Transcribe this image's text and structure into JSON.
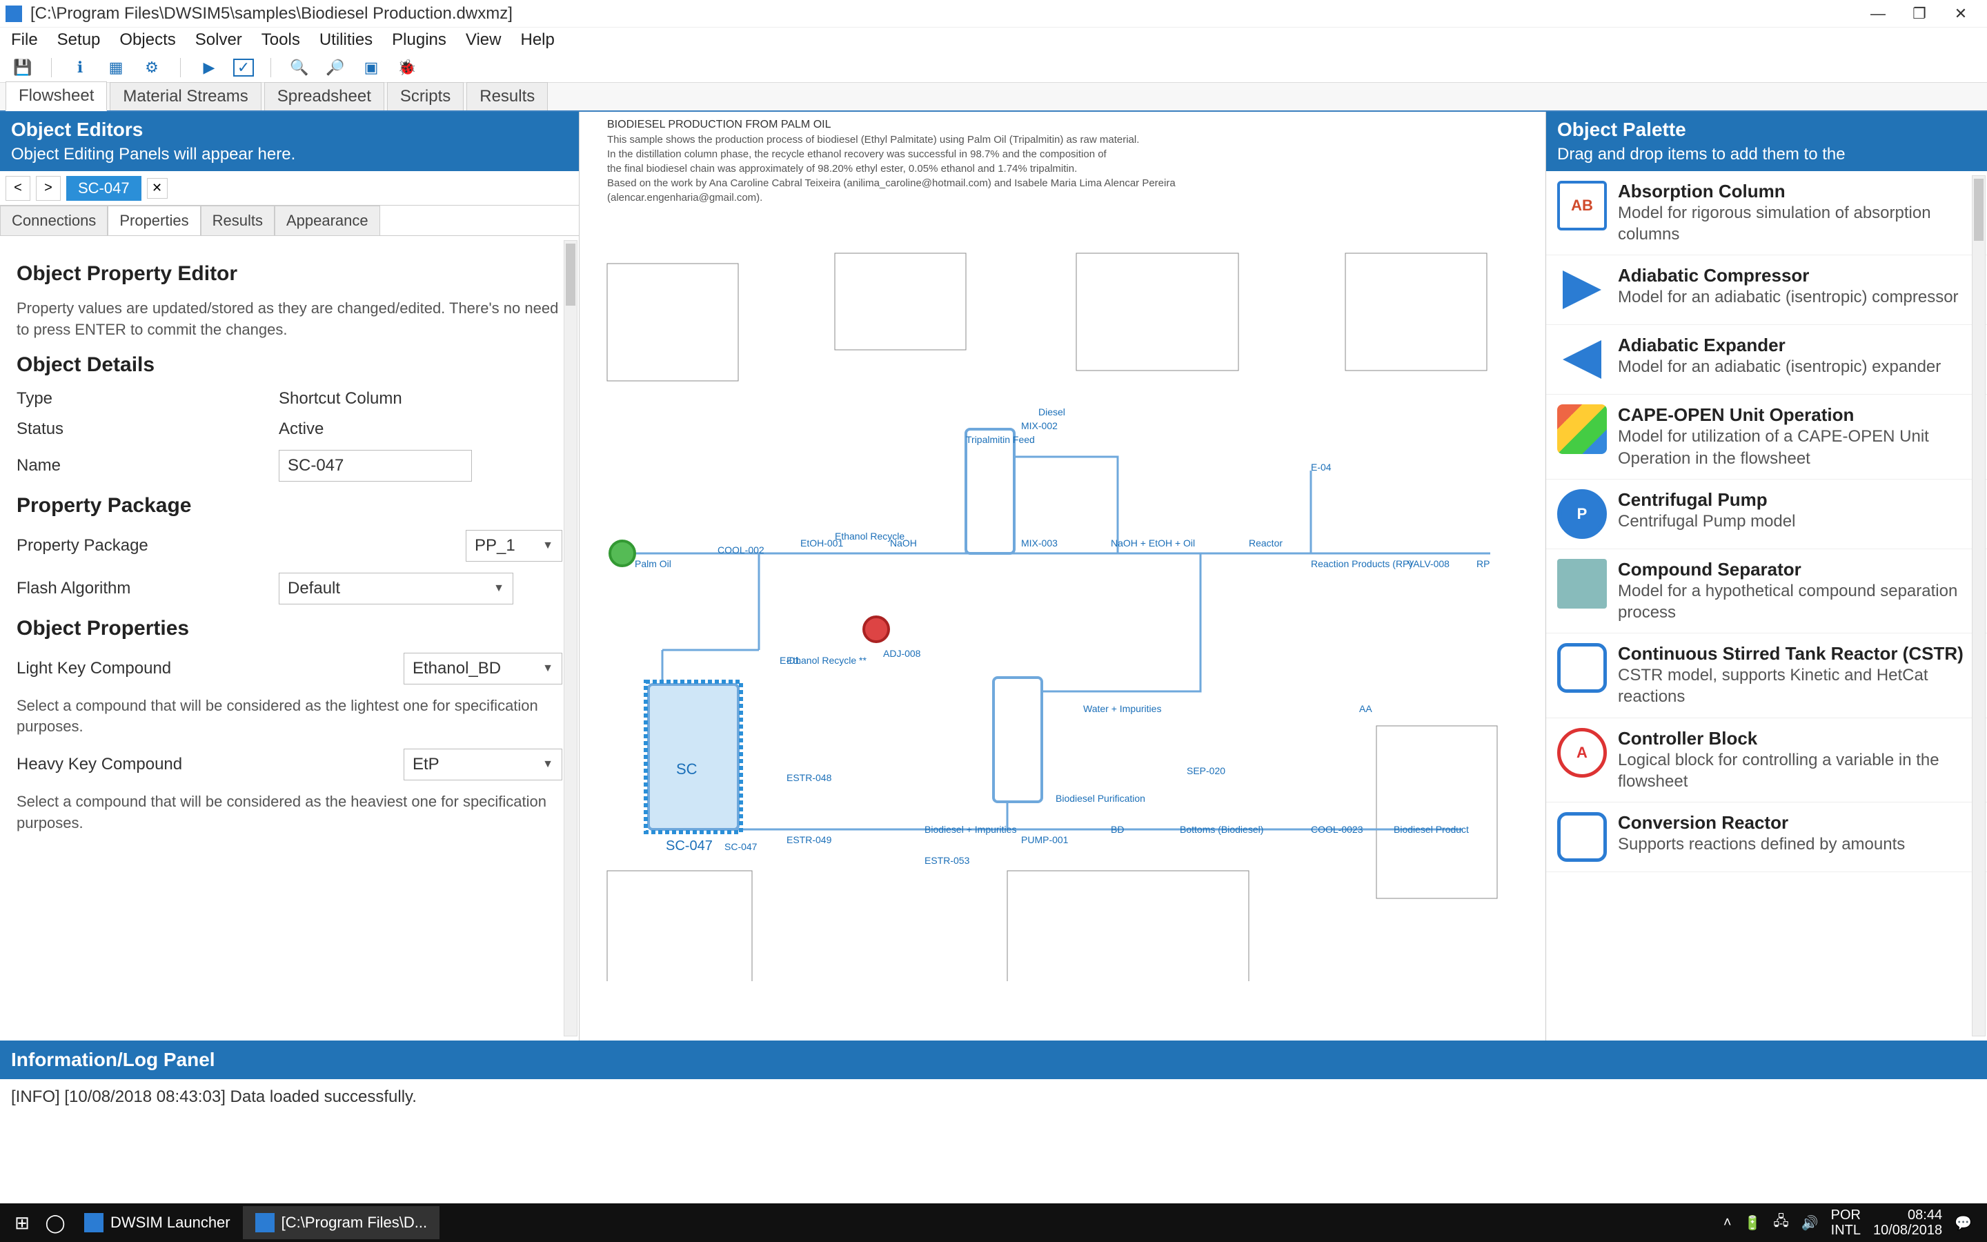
{
  "window": {
    "title": "[C:\\Program Files\\DWSIM5\\samples\\Biodiesel Production.dwxmz]"
  },
  "menubar": [
    "File",
    "Setup",
    "Objects",
    "Solver",
    "Tools",
    "Utilities",
    "Plugins",
    "View",
    "Help"
  ],
  "toolbar_icons": [
    "save-icon",
    "info-icon",
    "grid-icon",
    "settings-icon",
    "play-icon",
    "check-icon",
    "zoom-in-icon",
    "zoom-out-icon",
    "zoom-fit-icon",
    "debug-icon"
  ],
  "main_tabs": [
    "Flowsheet",
    "Material Streams",
    "Spreadsheet",
    "Scripts",
    "Results"
  ],
  "main_tab_active": 0,
  "left": {
    "header_title": "Object Editors",
    "header_sub": "Object Editing Panels will appear here.",
    "breadcrumb_active": "SC-047",
    "subtabs": [
      "Connections",
      "Properties",
      "Results",
      "Appearance"
    ],
    "subtab_active": 1,
    "editor": {
      "title": "Object Property Editor",
      "hint": "Property values are updated/stored as they are changed/edited. There's no need to press ENTER to commit the changes.",
      "section_details": "Object Details",
      "row_type_label": "Type",
      "row_type_value": "Shortcut Column",
      "row_status_label": "Status",
      "row_status_value": "Active",
      "row_name_label": "Name",
      "row_name_value": "SC-047",
      "section_package": "Property Package",
      "row_pp_label": "Property Package",
      "row_pp_value": "PP_1",
      "row_flash_label": "Flash Algorithm",
      "row_flash_value": "Default",
      "section_props": "Object Properties",
      "row_lk_label": "Light Key Compound",
      "row_lk_value": "Ethanol_BD",
      "row_lk_hint": "Select a compound that will be considered as the lightest one for specification purposes.",
      "row_hk_label": "Heavy Key Compound",
      "row_hk_value": "EtP",
      "row_hk_hint": "Select a compound that will be considered as the heaviest one for specification purposes."
    }
  },
  "canvas": {
    "desc_title": "BIODIESEL PRODUCTION FROM PALM OIL",
    "desc_l1": "This sample shows the production process of biodiesel (Ethyl Palmitate) using Palm Oil (Tripalmitin) as raw material.",
    "desc_l2": "In the distillation column phase, the recycle ethanol recovery was successful in 98.7% and the composition of",
    "desc_l3": "the final biodiesel chain was approximately of 98.20% ethyl ester, 0.05% ethanol and 1.74% tripalmitin.",
    "desc_l4": "Based on the work by Ana Caroline Cabral Teixeira (anilima_caroline@hotmail.com) and Isabele Maria Lima Alencar Pereira (alencar.engenharia@gmail.com).",
    "selected_block": "SC-047"
  },
  "right": {
    "header_title": "Object Palette",
    "header_sub": "Drag and drop items to add them to the",
    "items": [
      {
        "name": "Absorption Column",
        "desc": "Model for rigorous simulation of absorption columns",
        "icon": "ico-ab",
        "badge": "AB"
      },
      {
        "name": "Adiabatic Compressor",
        "desc": "Model for an adiabatic (isentropic) compressor",
        "icon": "ico-comp",
        "badge": ""
      },
      {
        "name": "Adiabatic Expander",
        "desc": "Model for an adiabatic (isentropic) expander",
        "icon": "ico-exp",
        "badge": ""
      },
      {
        "name": "CAPE-OPEN Unit Operation",
        "desc": "Model for utilization of a CAPE-OPEN Unit Operation in the flowsheet",
        "icon": "ico-cape",
        "badge": ""
      },
      {
        "name": "Centrifugal Pump",
        "desc": "Centrifugal Pump model",
        "icon": "ico-pump",
        "badge": "P"
      },
      {
        "name": "Compound Separator",
        "desc": "Model for a hypothetical compound separation process",
        "icon": "ico-sep",
        "badge": ""
      },
      {
        "name": "Continuous Stirred Tank Reactor (CSTR)",
        "desc": "CSTR model, supports Kinetic and HetCat reactions",
        "icon": "ico-cstr",
        "badge": ""
      },
      {
        "name": "Controller Block",
        "desc": "Logical block for controlling a variable in the flowsheet",
        "icon": "ico-ctrl",
        "badge": "A"
      },
      {
        "name": "Conversion Reactor",
        "desc": "Supports reactions defined by amounts",
        "icon": "ico-conv",
        "badge": ""
      }
    ]
  },
  "log": {
    "header": "Information/Log Panel",
    "line1": "[INFO] [10/08/2018 08:43:03] Data loaded successfully."
  },
  "taskbar": {
    "app1": "DWSIM Launcher",
    "app2": "[C:\\Program Files\\D...",
    "lang1": "POR",
    "lang2": "INTL",
    "time": "08:44",
    "date": "10/08/2018"
  }
}
